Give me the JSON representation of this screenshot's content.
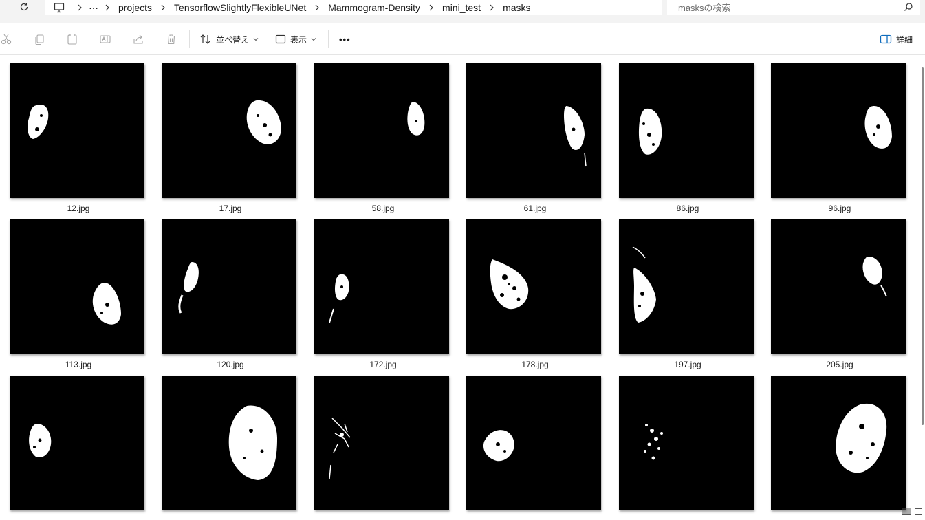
{
  "addressbar": {
    "refresh_icon": "refresh-icon",
    "device_icon": "computer-icon",
    "overflow": "···",
    "breadcrumbs": [
      "projects",
      "TensorflowSlightlyFlexibleUNet",
      "Mammogram-Density",
      "mini_test",
      "masks"
    ]
  },
  "search": {
    "placeholder": "masksの検索"
  },
  "toolbar": {
    "sort_label": "並べ替え",
    "view_label": "表示",
    "more_label": "•••",
    "details_label": "詳細"
  },
  "files": [
    {
      "name": "12.jpg"
    },
    {
      "name": "17.jpg"
    },
    {
      "name": "58.jpg"
    },
    {
      "name": "61.jpg"
    },
    {
      "name": "86.jpg"
    },
    {
      "name": "96.jpg"
    },
    {
      "name": "113.jpg"
    },
    {
      "name": "120.jpg"
    },
    {
      "name": "172.jpg"
    },
    {
      "name": "178.jpg"
    },
    {
      "name": "197.jpg"
    },
    {
      "name": "205.jpg"
    },
    {
      "name": ""
    },
    {
      "name": ""
    },
    {
      "name": ""
    },
    {
      "name": ""
    },
    {
      "name": ""
    },
    {
      "name": ""
    }
  ],
  "colors": {
    "background": "#ffffff",
    "addressbar": "#f3f3f3",
    "thumbnail": "#000000",
    "mask": "#ffffff"
  }
}
